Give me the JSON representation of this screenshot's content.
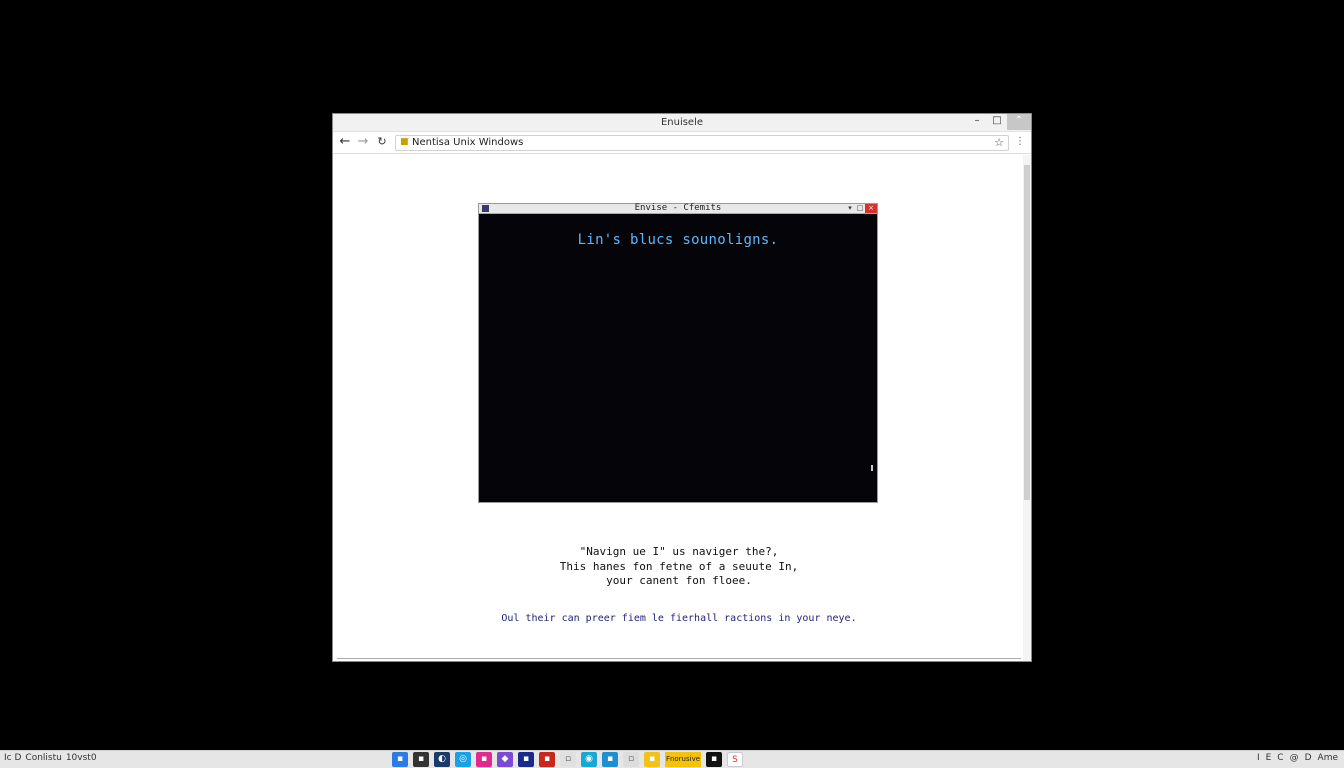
{
  "browser": {
    "window_title": "Enuisele",
    "address": "Nentisa Unix Windows",
    "controls": {
      "minimize": "–",
      "maximize": "□",
      "close": "⌃"
    }
  },
  "terminal": {
    "title": "Envise - Cfemits",
    "line": "Lin's blucs sounoligns.",
    "controls": {
      "minimize": "▾",
      "maximize": "□",
      "close": "×"
    }
  },
  "caption": {
    "line1": "\"Navign ue I\" us  naviger the?,",
    "line2": "This hanes fon fetne of a seuute In,",
    "line3": "your canent fon floee."
  },
  "footer_text": "Oul their can preer fiem le fierhall ractions in your neye.",
  "taskbar": {
    "left_items": [
      "Ic D",
      "Conlistu",
      "10vst0"
    ],
    "highlight_label": "Fnorusive",
    "right_icons": [
      "I",
      "E",
      "C",
      "@",
      "D",
      "Ame"
    ]
  },
  "colors": {
    "terminal_text": "#5bb8ff",
    "footer_text": "#23237a",
    "terminal_close": "#d9302b"
  }
}
